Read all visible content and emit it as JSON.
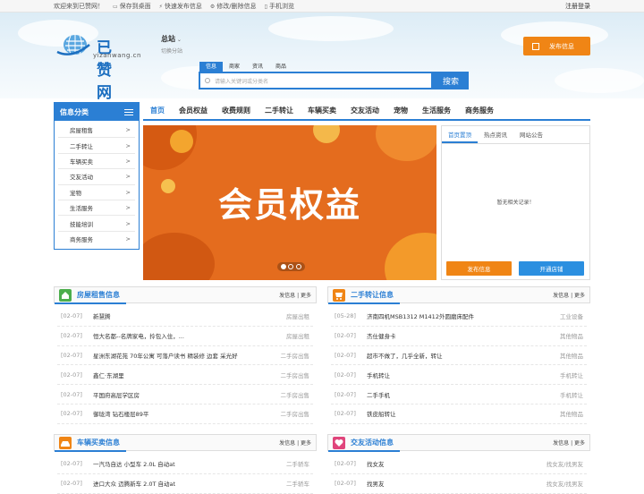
{
  "topbar": {
    "welcome": "欢迎来到已赞网！",
    "links": [
      {
        "icon": "monitor-icon",
        "label": "保存到桌面"
      },
      {
        "icon": "lightning-icon",
        "label": "快速发布信息"
      },
      {
        "icon": "gear-icon",
        "label": "修改/删除信息"
      },
      {
        "icon": "phone-icon",
        "label": "手机浏览"
      }
    ],
    "login": "注册",
    "register": "登录"
  },
  "header": {
    "logo_name": "已赞网",
    "logo_url": "yizanwang.cn",
    "city": "总站",
    "switch_city": "切换分站",
    "publish_label": "发布信息",
    "search_tabs": [
      "信息",
      "商家",
      "资讯",
      "商品"
    ],
    "search_placeholder": "请输入关键词或分类名",
    "search_button": "搜索"
  },
  "colors": {
    "primary": "#2b7fd4",
    "accent": "#f08515",
    "banner": "#e46c1e"
  },
  "categories": {
    "title": "信息分类",
    "items": [
      "房屋租售",
      "二手转让",
      "车辆买卖",
      "交友活动",
      "宠物",
      "生活服务",
      "技能培训",
      "商务服务"
    ]
  },
  "nav": [
    "首页",
    "会员权益",
    "收费规则",
    "二手转让",
    "车辆买卖",
    "交友活动",
    "宠物",
    "生活服务",
    "商务服务"
  ],
  "banner": {
    "text": "会员权益"
  },
  "top_panel": {
    "tabs": [
      "首页置顶",
      "热点资讯",
      "网站公告"
    ],
    "empty": "暂无相关记录！",
    "publish": "发布信息",
    "open_shop": "开通店铺"
  },
  "boxes": [
    {
      "title": "房屋租售信息",
      "more": "发信息 | 更多",
      "icon": "house-icon",
      "color": "#4cae4c",
      "rows": [
        {
          "date": "[02-07]",
          "title": "新慧腾",
          "cat": "房屋出租"
        },
        {
          "date": "[02-07]",
          "title": "恒大名都--名牌家电，拎包入住，...",
          "cat": "房屋出租"
        },
        {
          "date": "[02-07]",
          "title": "星洲东湖花苑 70年公寓 可落户读书 精装修 边套 采光好",
          "cat": "二手房出售"
        },
        {
          "date": "[02-07]",
          "title": "鑫仁·东湖里",
          "cat": "二手房出售"
        },
        {
          "date": "[02-07]",
          "title": "平国府高层学区房",
          "cat": "二手房出售"
        },
        {
          "date": "[02-07]",
          "title": "御珑湾 钻石楼层89平",
          "cat": "二手房出售"
        }
      ]
    },
    {
      "title": "二手转让信息",
      "more": "发信息 | 更多",
      "icon": "cart-icon",
      "color": "#f08515",
      "rows": [
        {
          "date": "[05-28]",
          "title": "济南四机MSB1312 M1412外圆磨床配件",
          "cat": "工业设备"
        },
        {
          "date": "[02-07]",
          "title": "杰仕健身卡",
          "cat": "其他物品"
        },
        {
          "date": "[02-07]",
          "title": "超市不做了，几乎全新，转让",
          "cat": "其他物品"
        },
        {
          "date": "[02-07]",
          "title": "手机转让",
          "cat": "手机转让"
        },
        {
          "date": "[02-07]",
          "title": "二手手机",
          "cat": "手机转让"
        },
        {
          "date": "[02-07]",
          "title": "铁皮船转让",
          "cat": "其他物品"
        }
      ]
    },
    {
      "title": "车辆买卖信息",
      "more": "发信息 | 更多",
      "icon": "car-icon",
      "color": "#f08515",
      "rows": [
        {
          "date": "[02-07]",
          "title": "一汽马自达 小型车 2.0L 自动at",
          "cat": "二手轿车"
        },
        {
          "date": "[02-07]",
          "title": "进口大众 迈腾新车 2.0T 自动at",
          "cat": "二手轿车"
        }
      ]
    },
    {
      "title": "交友活动信息",
      "more": "发信息 | 更多",
      "icon": "heart-icon",
      "color": "#e0457b",
      "rows": [
        {
          "date": "[02-07]",
          "title": "找女友",
          "cat": "找女友/找男友"
        },
        {
          "date": "[02-07]",
          "title": "找男友",
          "cat": "找女友/找男友"
        }
      ]
    }
  ]
}
